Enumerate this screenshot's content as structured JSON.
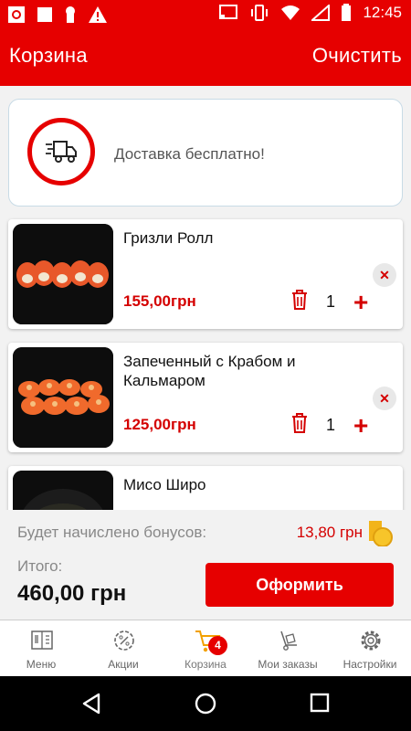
{
  "status_bar": {
    "time": "12:45"
  },
  "header": {
    "title": "Корзина",
    "clear_label": "Очистить"
  },
  "delivery": {
    "text": "Доставка бесплатно!",
    "icon": "truck-icon"
  },
  "cart_items": [
    {
      "name": "Гризли Ролл",
      "price": "155,00грн",
      "quantity": "1"
    },
    {
      "name": "Запеченный с Крабом и Кальмаром",
      "price": "125,00грн",
      "quantity": "1"
    },
    {
      "name": "Мисо Широ",
      "price": "",
      "quantity": ""
    }
  ],
  "summary": {
    "bonus_label": "Будет начислено бонусов:",
    "bonus_value": "13,80 грн",
    "total_label": "Итого:",
    "total_value": "460,00 грн",
    "checkout_label": "Оформить"
  },
  "bottom_nav": [
    {
      "label": "Меню",
      "icon": "menu-book-icon"
    },
    {
      "label": "Акции",
      "icon": "percent-gear-icon"
    },
    {
      "label": "Корзина",
      "icon": "cart-icon",
      "badge": "4",
      "active": true
    },
    {
      "label": "Мои заказы",
      "icon": "hand-truck-icon"
    },
    {
      "label": "Настройки",
      "icon": "gear-icon"
    }
  ],
  "colors": {
    "accent": "#e60000",
    "price": "#d40000"
  }
}
